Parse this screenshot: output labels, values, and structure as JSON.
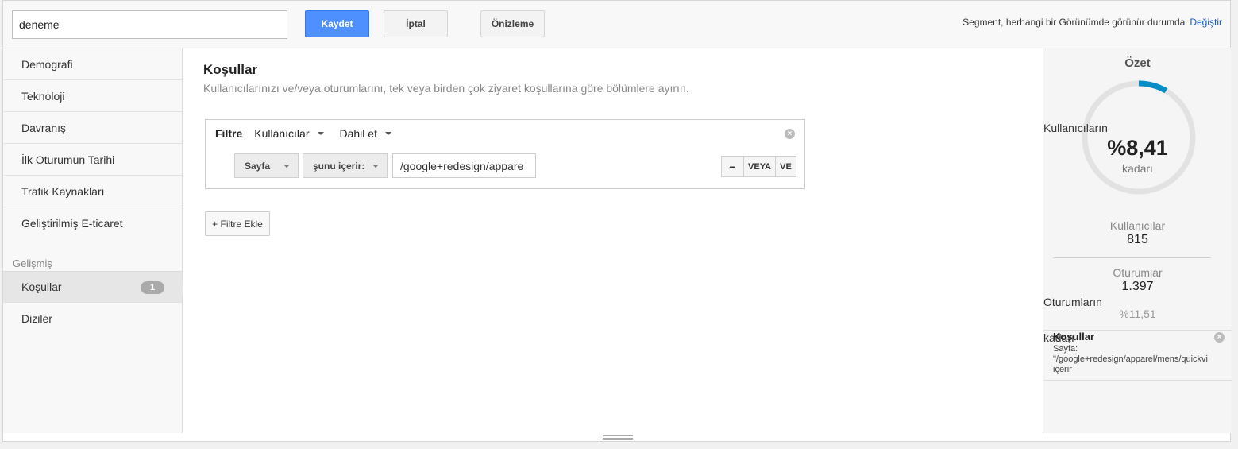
{
  "topbar": {
    "segment_name": "deneme",
    "save_label": "Kaydet",
    "cancel_label": "İptal",
    "preview_label": "Önizleme",
    "visibility_note": "Segment, herhangi bir Görünümde görünür durumda",
    "change_link": "Değiştir"
  },
  "sidebar": {
    "items": [
      {
        "label": "Demografi"
      },
      {
        "label": "Teknoloji"
      },
      {
        "label": "Davranış"
      },
      {
        "label": "İlk Oturumun Tarihi"
      },
      {
        "label": "Trafik Kaynakları"
      },
      {
        "label": "Geliştirilmiş E-ticaret"
      }
    ],
    "advanced_header": "Gelişmiş",
    "advanced_items": [
      {
        "label": "Koşullar",
        "badge": "1",
        "active": true
      },
      {
        "label": "Diziler"
      }
    ]
  },
  "main": {
    "title": "Koşullar",
    "description": "Kullanıcılarınızı ve/veya oturumlarını, tek veya birden çok ziyaret koşullarına göre bölümlere ayırın.",
    "filter": {
      "label": "Filtre",
      "scope": "Kullanıcılar",
      "mode": "Dahil et",
      "dimension": "Sayfa",
      "operator": "şunu içerir:",
      "value": "/google+redesign/appare",
      "minus_label": "−",
      "or_label": "VEYA",
      "and_label": "VE",
      "remove_icon": "close-circle-icon"
    },
    "add_filter_label": "+ Filtre Ekle"
  },
  "summary": {
    "title": "Özet",
    "users_of": "Kullanıcıların",
    "percent": "%8,41",
    "percent_suffix": "kadarı",
    "percent_value": 8.41,
    "donut_color": "#058dc7",
    "users_label": "Kullanıcılar",
    "users_value": "815",
    "sessions_label": "Oturumlar",
    "sessions_value": "1.397",
    "sessions_of": "Oturumların",
    "sessions_percent": "%11,51",
    "sessions_suffix": "kadarı",
    "condition_title": "Koşullar",
    "condition_line1": "Sayfa:",
    "condition_line2": "\"/google+redesign/apparel/mens/quickvi",
    "condition_line3": "içerir"
  }
}
